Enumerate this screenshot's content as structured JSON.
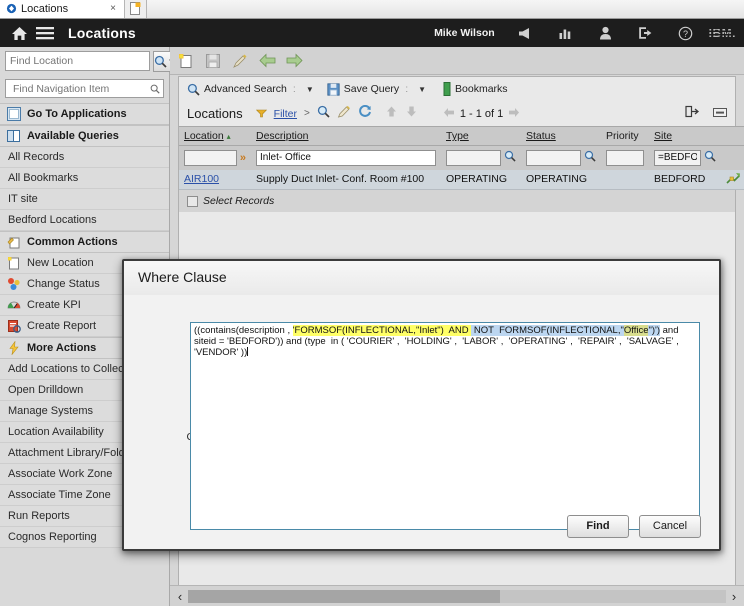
{
  "browser": {
    "tab_title": "Locations",
    "tab_close": "×",
    "new_tab_icon": "new-tab-icon",
    "favicon": "maximo-favicon"
  },
  "header": {
    "home_icon": "home-icon",
    "menu_icon": "hamburger-menu-icon",
    "title": "Locations",
    "user": "Mike Wilson",
    "tools": [
      {
        "name": "bulletin-board-icon",
        "glyph": "◀"
      },
      {
        "name": "reports-chart-icon",
        "glyph": "▮▮"
      },
      {
        "name": "profile-icon",
        "glyph": "person"
      },
      {
        "name": "sign-out-icon",
        "glyph": "exit"
      },
      {
        "name": "help-icon",
        "glyph": "?"
      }
    ],
    "brand": "IBM."
  },
  "sidebar": {
    "find_location": {
      "placeholder": "Find Location",
      "value": "",
      "search_icon": "search-icon",
      "dropdown_icon": "chevron-down-icon"
    },
    "nav_search": {
      "placeholder": "Find Navigation Item",
      "value": "",
      "icon": "search-icon"
    },
    "sections": [
      {
        "label": "Go To Applications",
        "icon": "applications-icon",
        "items": []
      },
      {
        "label": "Available Queries",
        "icon": "queries-icon",
        "items": [
          {
            "label": "All Records"
          },
          {
            "label": "All Bookmarks"
          },
          {
            "label": "IT site"
          },
          {
            "label": "Bedford Locations"
          }
        ]
      },
      {
        "label": "Common Actions",
        "icon": "common-actions-icon",
        "items": [
          {
            "label": "New Location",
            "icon": "new-location-icon"
          },
          {
            "label": "Change Status",
            "icon": "change-status-icon"
          },
          {
            "label": "Create KPI",
            "icon": "kpi-gauge-icon"
          },
          {
            "label": "Create Report",
            "icon": "create-report-icon"
          }
        ]
      },
      {
        "label": "More Actions",
        "icon": "more-actions-lightning-icon",
        "items": [
          {
            "label": "Add Locations to Collections"
          },
          {
            "label": "Open Drilldown"
          },
          {
            "label": "Manage Systems"
          },
          {
            "label": "Location Availability"
          },
          {
            "label": "Attachment Library/Folders"
          },
          {
            "label": "Associate Work Zone"
          },
          {
            "label": "Associate Time Zone"
          },
          {
            "label": "Run Reports"
          },
          {
            "label": "Cognos Reporting"
          }
        ]
      }
    ]
  },
  "toolbar": {
    "icons": [
      {
        "name": "new-record-icon"
      },
      {
        "name": "save-icon"
      },
      {
        "name": "clear-changes-icon"
      },
      {
        "name": "previous-record-icon"
      },
      {
        "name": "next-record-icon"
      }
    ]
  },
  "searchbar": {
    "advanced_search": "Advanced Search",
    "advanced_search_icon": "search-icon",
    "save_query": "Save Query",
    "save_query_icon": "save-disk-icon",
    "bookmarks": "Bookmarks",
    "bookmarks_icon": "bookmark-icon",
    "dropdown_icon": "chevron-down-icon"
  },
  "list": {
    "title": "Locations",
    "filter_label": "Filter",
    "filter_icon": "filter-triangle-icon",
    "next_icon": ">",
    "search_icon": "search-icon",
    "clear_icon": "clear-filter-icon",
    "refresh_icon": "refresh-icon",
    "up_icon": "arrow-up-icon",
    "down_icon": "arrow-down-icon",
    "prev_page_icon": "previous-page-icon",
    "paging": "1 - 1 of 1",
    "next_page_icon": "next-page-icon",
    "download_icon": "download-icon",
    "collapse_icon": "collapse-icon",
    "columns": [
      {
        "label": "Location",
        "sort_icon": "sort-ascending-icon"
      },
      {
        "label": "Description"
      },
      {
        "label": "Type"
      },
      {
        "label": "Status"
      },
      {
        "label": "Priority"
      },
      {
        "label": "Site"
      }
    ],
    "filters": {
      "location": "",
      "expand_icon": "double-chevron-right-icon",
      "description": "Inlet- Office",
      "type": "",
      "type_lookup_icon": "lookup-icon",
      "status": "",
      "status_lookup_icon": "lookup-icon",
      "priority": "",
      "site": "=BEDFORD",
      "site_lookup_icon": "lookup-icon"
    },
    "rows": [
      {
        "location": "AIR100",
        "description": "Supply Duct Inlet- Conf. Room #100",
        "type": "OPERATING",
        "status": "OPERATING",
        "priority": "",
        "site": "BEDFORD",
        "row_icon": "drilldown-icon"
      }
    ],
    "select_records": "Select Records"
  },
  "scrollbar": {
    "left_arrow": "‹",
    "right_arrow": "›"
  },
  "dialog": {
    "title": "Where Clause",
    "current_query_label": "Current Query:",
    "query_segments": [
      {
        "text": "((contains(description , ",
        "style": "plain"
      },
      {
        "text": "'FORMSOF(INFLECTIONAL,\"Inlet\")  AND ",
        "style": "yellow"
      },
      {
        "text": " NOT  FORMSOF(INFLECTIONAL,\"",
        "style": "blue"
      },
      {
        "text": "Office",
        "style": "blue-yellow"
      },
      {
        "text": "\")')",
        "style": "blue"
      },
      {
        "text": " and siteid = 'BEDFORD')) and (type  in ( 'COURIER' ,  'HOLDING' ,  'LABOR' ,  'OPERATING' ,  'REPAIR' ,  'SALVAGE' ,  'VENDOR' ))",
        "style": "plain"
      }
    ],
    "query_plain": "((contains(description , 'FORMSOF(INFLECTIONAL,\"Inlet\")  AND  NOT  FORMSOF(INFLECTIONAL,\"Office\")')  and siteid = 'BEDFORD')) and (type  in ( 'COURIER' ,  'HOLDING' ,  'LABOR' ,  'OPERATING' ,  'REPAIR' ,  'SALVAGE' ,  'VENDOR' ))",
    "find_button": "Find",
    "cancel_button": "Cancel"
  }
}
